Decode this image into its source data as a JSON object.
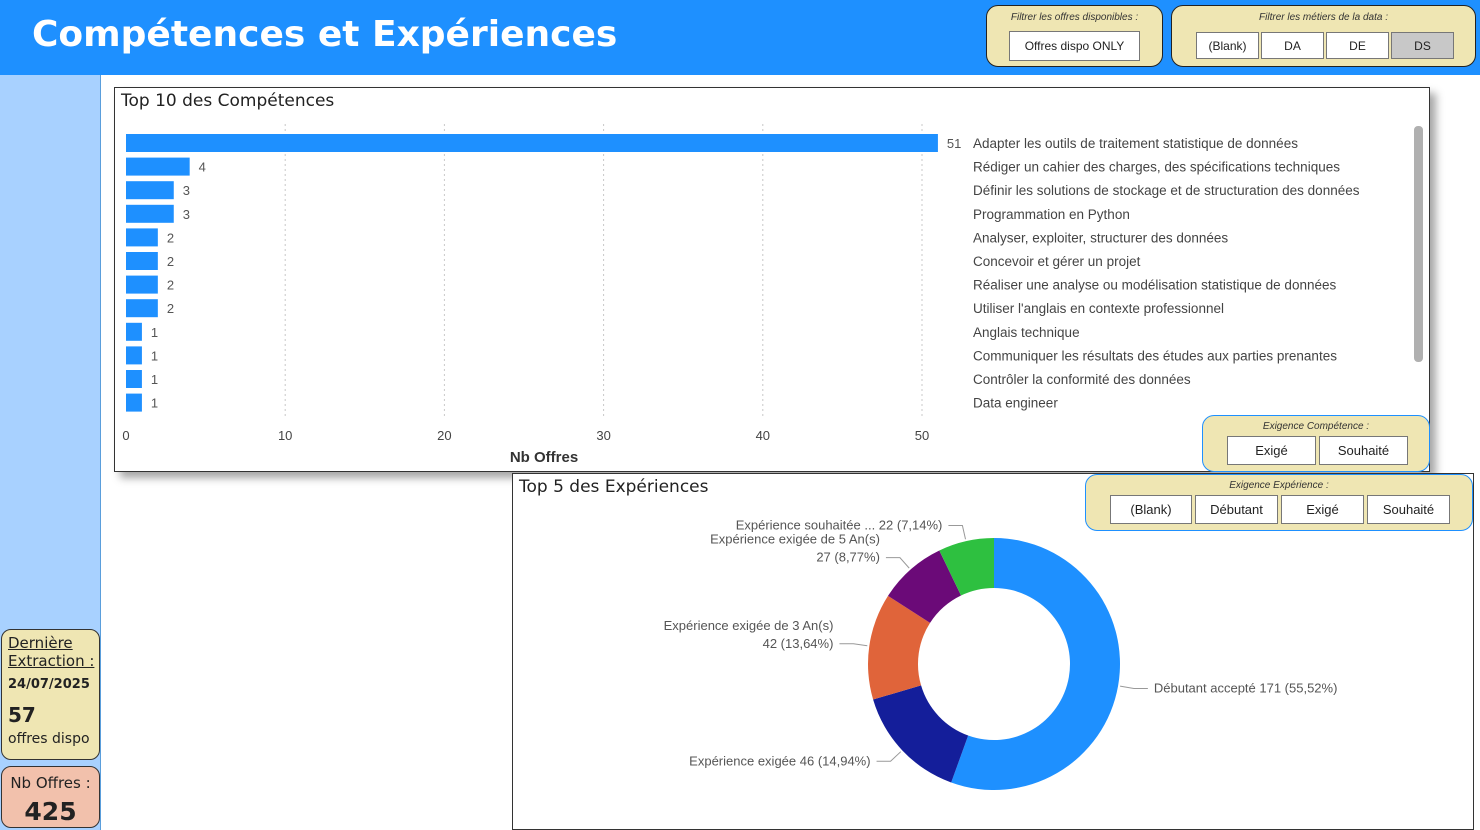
{
  "header": {
    "title": "Compétences et Expériences"
  },
  "filters": {
    "offres": {
      "caption": "Filtrer les offres disponibles :",
      "button": "Offres dispo ONLY"
    },
    "metiers": {
      "caption": "Filtrer les métiers de la data :",
      "buttons": [
        "(Blank)",
        "DA",
        "DE",
        "DS"
      ],
      "selected": "DS"
    },
    "competence": {
      "caption": "Exigence Compétence :",
      "buttons": [
        "Exigé",
        "Souhaité"
      ]
    },
    "experience": {
      "caption": "Exigence Expérience :",
      "buttons": [
        "(Blank)",
        "Débutant",
        "Exigé",
        "Souhaité"
      ]
    }
  },
  "sidebar": {
    "extraction_label_1": "Dernière",
    "extraction_label_2": "Extraction :",
    "extraction_date": "24/07/2025",
    "dispo_count": "57",
    "dispo_label": "offres dispo",
    "nb_offres_label": "Nb Offres :",
    "nb_offres_value": "425"
  },
  "chart_data": [
    {
      "type": "bar",
      "orientation": "horizontal",
      "title": "Top 10 des Compétences",
      "xlabel": "Nb Offres",
      "xlim": [
        0,
        51
      ],
      "xticks": [
        0,
        10,
        20,
        30,
        40,
        50
      ],
      "categories": [
        "Adapter les outils de traitement statistique de données",
        "Rédiger un cahier des charges, des spécifications techniques",
        "Définir les solutions de stockage et de structuration des données",
        "Programmation en Python",
        "Analyser, exploiter, structurer des données",
        "Concevoir et gérer un projet",
        "Réaliser une analyse ou modélisation statistique de données",
        "Utiliser l'anglais en contexte professionnel",
        "Anglais technique",
        "Communiquer les résultats des études aux parties prenantes",
        "Contrôler la conformité des données",
        "Data engineer"
      ],
      "values": [
        51,
        4,
        3,
        3,
        2,
        2,
        2,
        2,
        1,
        1,
        1,
        1
      ],
      "color": "#1e90ff",
      "grid": true
    },
    {
      "type": "pie",
      "donut": true,
      "title": "Top 5 des Expériences",
      "slices": [
        {
          "label": "Débutant accepté 171 (55,52%)",
          "value": 171,
          "color": "#1e90ff"
        },
        {
          "label": "Expérience exigée 46 (14,94%)",
          "value": 46,
          "color": "#141e9a"
        },
        {
          "label": [
            "Expérience exigée de 3 An(s)",
            "42 (13,64%)"
          ],
          "value": 42,
          "color": "#e0643a"
        },
        {
          "label": [
            "Expérience exigée de 5 An(s)",
            "27 (8,77%)"
          ],
          "value": 27,
          "color": "#6b0a78"
        },
        {
          "label": "Expérience souhaitée ... 22 (7,14%)",
          "value": 22,
          "color": "#2ec040"
        }
      ]
    }
  ]
}
